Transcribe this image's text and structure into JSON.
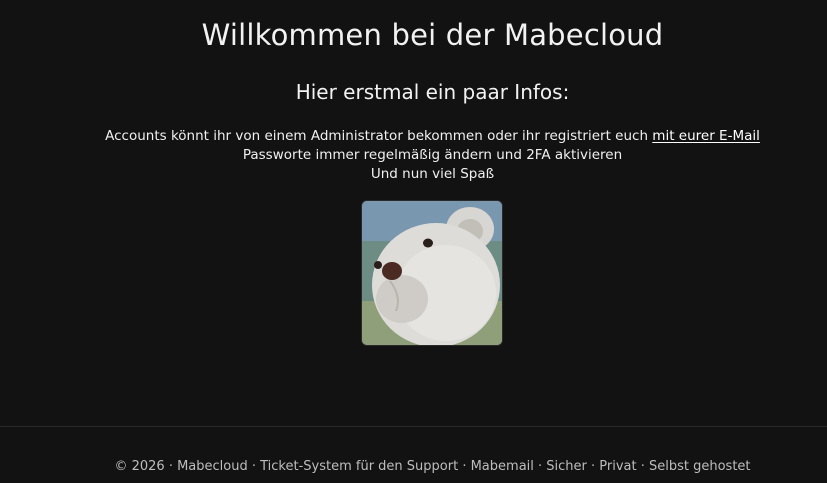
{
  "header": {
    "title": "Willkommen bei der Mabecloud",
    "subtitle": "Hier erstmal ein paar Infos:"
  },
  "info": {
    "line1_text": "Accounts könnt ihr von einem Administrator bekommen oder ihr registriert euch ",
    "line1_link": "mit eurer E-Mail",
    "line2": "Passworte immer regelmäßig ändern und 2FA aktivieren",
    "line3": "Und nun viel Spaß"
  },
  "image": {
    "icon": "teddy-bear-photo"
  },
  "footer": {
    "copyright": "© 2026 · ",
    "brand_link": "Mabecloud",
    "rest": " · Ticket-System für den Support · Mabemail · Sicher · Privat · Selbst gehostet"
  }
}
